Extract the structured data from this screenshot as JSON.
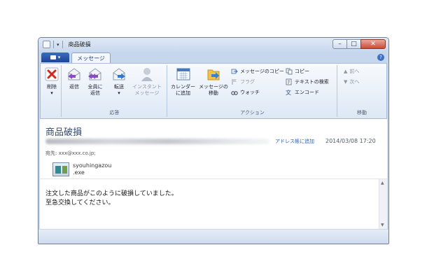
{
  "window": {
    "title": "商品破損"
  },
  "caption": {
    "minimize": "–",
    "maximize": "□",
    "close": "✕"
  },
  "tabs": {
    "file_icon": "file-menu-icon",
    "message": "メッセージ"
  },
  "ribbon": {
    "groups": {
      "respond": "応答",
      "actions": "アクション",
      "move": "移動"
    },
    "delete": "削除",
    "reply": "返信",
    "reply_all": [
      "全員に",
      "返信"
    ],
    "forward": "転送",
    "im": [
      "インスタント",
      "メッセージ"
    ],
    "calendar": [
      "カレンダー",
      "に追加"
    ],
    "move_message": [
      "メッセージの",
      "移動"
    ],
    "copy_message": "メッセージのコピー",
    "flag": "フラグ",
    "watch": "ウォッチ",
    "copy": "コピー",
    "find_text": "テキストの検索",
    "encode": "エンコード",
    "prev": "前へ",
    "next": "次へ"
  },
  "message": {
    "subject": "商品破損",
    "add_to_contacts": "アドレス帳に追加",
    "datetime": "2014/03/08 17:20",
    "to": "宛先: xxx@xxx.co.jp;",
    "attachment": [
      "syouhingazou",
      ".exe"
    ],
    "body": [
      "注文した商品がこのように破損していました。",
      "至急交換してください。"
    ]
  },
  "colors": {
    "accent": "#1c4596",
    "link": "#2a62b8",
    "close": "#c94c36"
  }
}
